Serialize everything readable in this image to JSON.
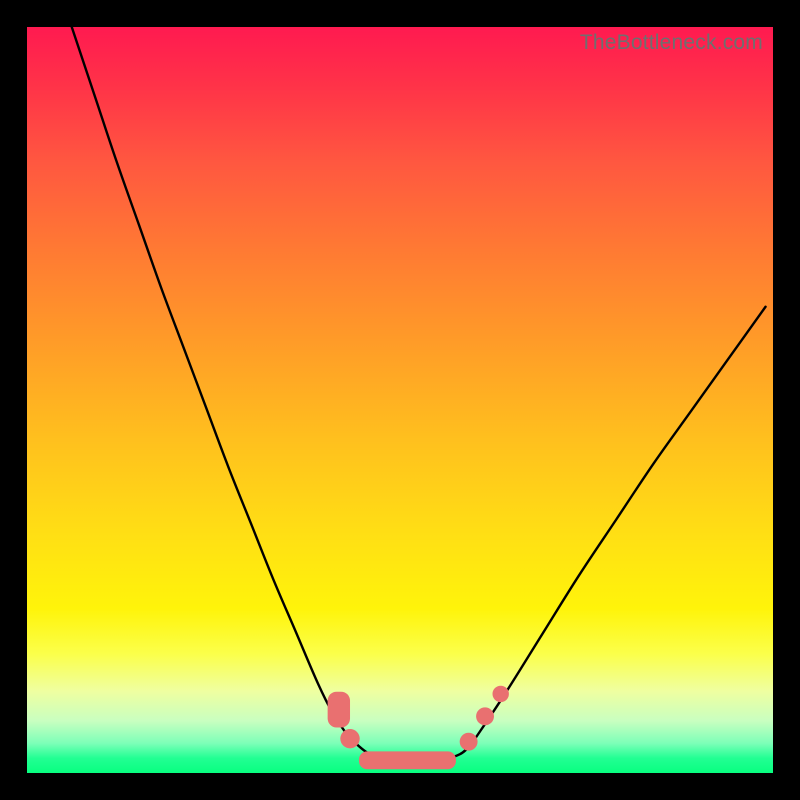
{
  "watermark": "TheBottleneck.com",
  "chart_data": {
    "type": "line",
    "title": "",
    "xlabel": "",
    "ylabel": "",
    "xlim": [
      0,
      1
    ],
    "ylim": [
      0,
      1
    ],
    "legend": false,
    "grid": false,
    "background": "vertical gradient red→orange→yellow→green (top→bottom)",
    "note": "Axes unlabeled; values are normalized fractions of plot area. y measured from top (0) to bottom (1).",
    "series": [
      {
        "name": "left-branch",
        "stroke": "#000000",
        "x": [
          0.06,
          0.09,
          0.12,
          0.15,
          0.18,
          0.21,
          0.24,
          0.27,
          0.3,
          0.33,
          0.36,
          0.39,
          0.41,
          0.43
        ],
        "y": [
          0.0,
          0.09,
          0.18,
          0.265,
          0.35,
          0.43,
          0.51,
          0.59,
          0.665,
          0.74,
          0.81,
          0.88,
          0.92,
          0.95
        ]
      },
      {
        "name": "valley-floor",
        "stroke": "#000000",
        "x": [
          0.43,
          0.46,
          0.5,
          0.54,
          0.58,
          0.6
        ],
        "y": [
          0.95,
          0.975,
          0.985,
          0.985,
          0.975,
          0.955
        ]
      },
      {
        "name": "right-branch",
        "stroke": "#000000",
        "x": [
          0.6,
          0.64,
          0.69,
          0.74,
          0.79,
          0.84,
          0.89,
          0.94,
          0.99
        ],
        "y": [
          0.955,
          0.895,
          0.815,
          0.735,
          0.66,
          0.585,
          0.515,
          0.445,
          0.375
        ]
      }
    ],
    "markers": [
      {
        "shape": "rounded-rect",
        "fill": "#e97070",
        "cx": 0.418,
        "cy": 0.915,
        "w": 0.03,
        "h": 0.048,
        "r": 0.012
      },
      {
        "shape": "circle",
        "fill": "#e97070",
        "cx": 0.433,
        "cy": 0.954,
        "r": 0.013
      },
      {
        "shape": "rounded-rect",
        "fill": "#e97070",
        "cx": 0.51,
        "cy": 0.983,
        "w": 0.13,
        "h": 0.024,
        "r": 0.011
      },
      {
        "shape": "circle",
        "fill": "#e97070",
        "cx": 0.592,
        "cy": 0.958,
        "r": 0.012
      },
      {
        "shape": "circle",
        "fill": "#e97070",
        "cx": 0.614,
        "cy": 0.924,
        "r": 0.012
      },
      {
        "shape": "circle",
        "fill": "#e97070",
        "cx": 0.635,
        "cy": 0.894,
        "r": 0.011
      }
    ]
  }
}
